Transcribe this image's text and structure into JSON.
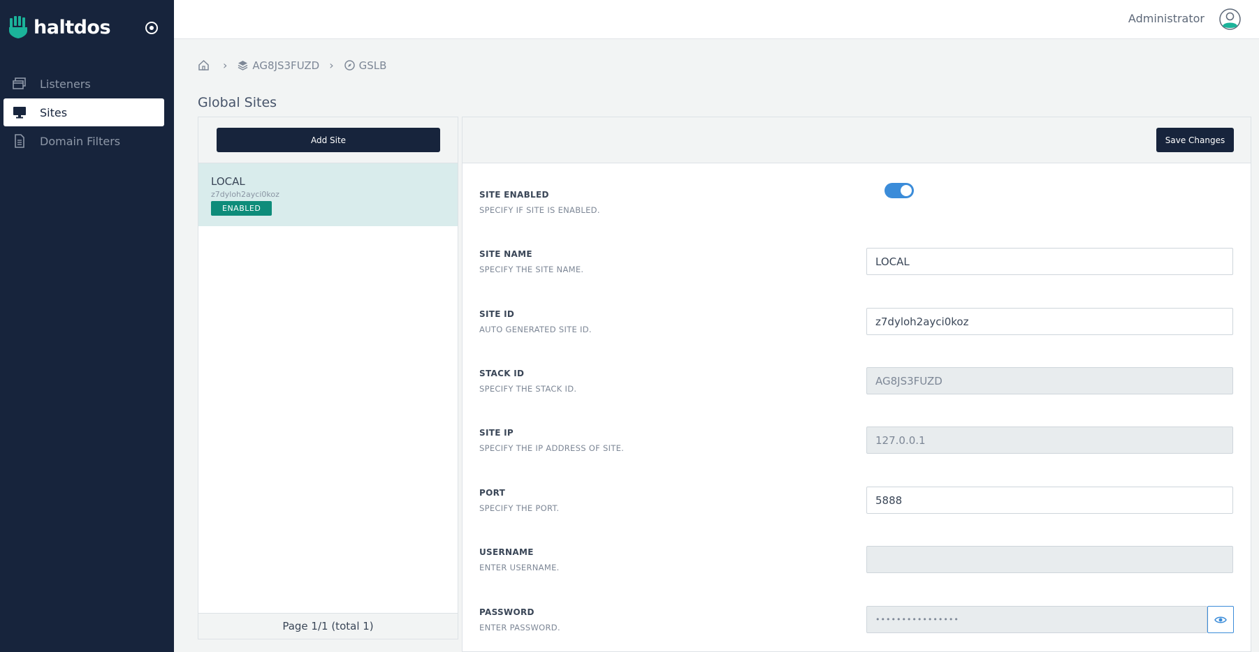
{
  "app": {
    "logo_text": "haltdos"
  },
  "sidebar": {
    "items": [
      {
        "label": "Listeners",
        "icon": "window-stack-icon",
        "active": false
      },
      {
        "label": "Sites",
        "icon": "monitor-icon",
        "active": true
      },
      {
        "label": "Domain Filters",
        "icon": "document-icon",
        "active": false
      }
    ]
  },
  "topbar": {
    "user_name": "Administrator"
  },
  "breadcrumb": {
    "stack": "AG8JS3FUZD",
    "page": "GSLB"
  },
  "page_title": "Global Sites",
  "list": {
    "add_label": "Add Site",
    "sites": [
      {
        "name": "LOCAL",
        "id": "z7dyloh2ayci0koz",
        "status": "ENABLED"
      }
    ],
    "pagination": "Page 1/1 (total 1)"
  },
  "detail": {
    "save_label": "Save Changes",
    "fields": {
      "enabled": {
        "label": "SITE ENABLED",
        "desc": "SPECIFY IF SITE IS ENABLED.",
        "value": true
      },
      "name": {
        "label": "SITE NAME",
        "desc": "SPECIFY THE SITE NAME.",
        "value": "LOCAL"
      },
      "site_id": {
        "label": "SITE ID",
        "desc": "AUTO GENERATED SITE ID.",
        "value": "z7dyloh2ayci0koz"
      },
      "stack_id": {
        "label": "STACK ID",
        "desc": "SPECIFY THE STACK ID.",
        "value": "AG8JS3FUZD"
      },
      "site_ip": {
        "label": "SITE IP",
        "desc": "SPECIFY THE IP ADDRESS OF SITE.",
        "value": "127.0.0.1"
      },
      "port": {
        "label": "PORT",
        "desc": "SPECIFY THE PORT.",
        "value": "5888"
      },
      "username": {
        "label": "USERNAME",
        "desc": "ENTER USERNAME.",
        "value": ""
      },
      "password": {
        "label": "PASSWORD",
        "desc": "ENTER PASSWORD.",
        "value": "••••••••••••••••"
      }
    }
  },
  "colors": {
    "sidebar_bg": "#17243c",
    "accent": "#3b8cd9",
    "badge": "#0e8c7a",
    "logo_green": "#1bb39a"
  }
}
